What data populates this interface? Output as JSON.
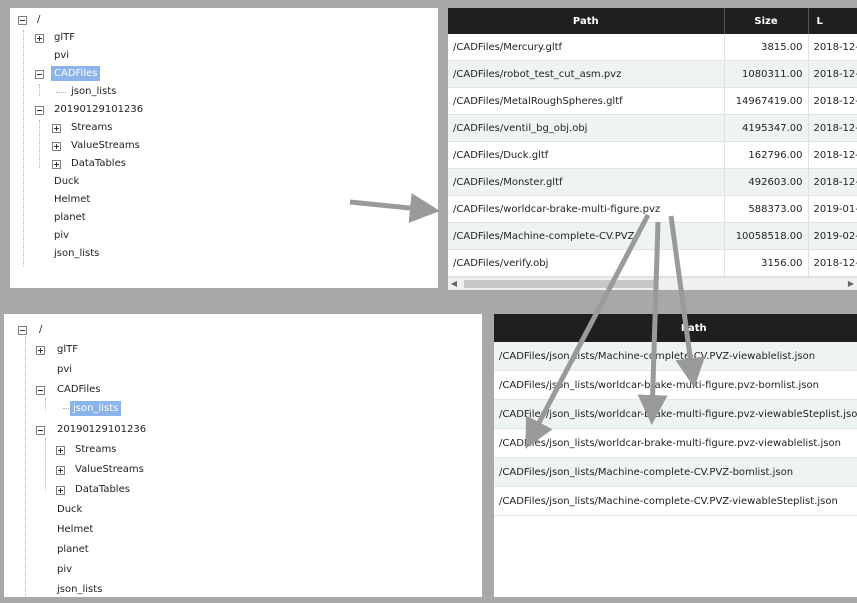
{
  "top_tree": {
    "nodes": [
      {
        "label": "/",
        "toggle": "minus"
      },
      {
        "label": "glTF",
        "toggle": "plus"
      },
      {
        "label": "pvi",
        "toggle": ""
      },
      {
        "label": "CADFiles",
        "toggle": "minus",
        "selected": true
      },
      {
        "label": "json_lists",
        "toggle": ""
      },
      {
        "label": "20190129101236",
        "toggle": "minus"
      },
      {
        "label": "Streams",
        "toggle": "plus"
      },
      {
        "label": "ValueStreams",
        "toggle": "plus"
      },
      {
        "label": "DataTables",
        "toggle": "plus"
      },
      {
        "label": "Duck",
        "toggle": ""
      },
      {
        "label": "Helmet",
        "toggle": ""
      },
      {
        "label": "planet",
        "toggle": ""
      },
      {
        "label": "piv",
        "toggle": ""
      },
      {
        "label": "json_lists",
        "toggle": ""
      }
    ]
  },
  "top_table": {
    "columns": [
      "Path",
      "Size",
      "L"
    ],
    "rows": [
      {
        "path": "/CADFiles/Mercury.gltf",
        "size": "3815.00",
        "date": "2018-12-"
      },
      {
        "path": "/CADFiles/robot_test_cut_asm.pvz",
        "size": "1080311.00",
        "date": "2018-12-"
      },
      {
        "path": "/CADFiles/MetalRoughSpheres.gltf",
        "size": "14967419.00",
        "date": "2018-12-"
      },
      {
        "path": "/CADFiles/ventil_bg_obj.obj",
        "size": "4195347.00",
        "date": "2018-12-"
      },
      {
        "path": "/CADFiles/Duck.gltf",
        "size": "162796.00",
        "date": "2018-12-"
      },
      {
        "path": "/CADFiles/Monster.gltf",
        "size": "492603.00",
        "date": "2018-12-"
      },
      {
        "path": "/CADFiles/worldcar-brake-multi-figure.pvz",
        "size": "588373.00",
        "date": "2019-01-"
      },
      {
        "path": "/CADFiles/Machine-complete-CV.PVZ",
        "size": "10058518.00",
        "date": "2019-02-"
      },
      {
        "path": "/CADFiles/verify.obj",
        "size": "3156.00",
        "date": "2018-12-"
      }
    ]
  },
  "bottom_tree": {
    "nodes": [
      {
        "label": "/",
        "toggle": "minus"
      },
      {
        "label": "glTF",
        "toggle": "plus"
      },
      {
        "label": "pvi",
        "toggle": ""
      },
      {
        "label": "CADFiles",
        "toggle": "minus"
      },
      {
        "label": "json_lists",
        "toggle": "",
        "selected": true
      },
      {
        "label": "20190129101236",
        "toggle": "minus"
      },
      {
        "label": "Streams",
        "toggle": "plus"
      },
      {
        "label": "ValueStreams",
        "toggle": "plus"
      },
      {
        "label": "DataTables",
        "toggle": "plus"
      },
      {
        "label": "Duck",
        "toggle": ""
      },
      {
        "label": "Helmet",
        "toggle": ""
      },
      {
        "label": "planet",
        "toggle": ""
      },
      {
        "label": "piv",
        "toggle": ""
      },
      {
        "label": "json_lists",
        "toggle": ""
      }
    ]
  },
  "bottom_table": {
    "columns": [
      "Path"
    ],
    "rows": [
      "/CADFiles/json_lists/Machine-complete-CV.PVZ-viewablelist.json",
      "/CADFiles/json_lists/worldcar-brake-multi-figure.pvz-bomlist.json",
      "/CADFiles/json_lists/worldcar-brake-multi-figure.pvz-viewableSteplist.json",
      "/CADFiles/json_lists/worldcar-brake-multi-figure.pvz-viewablelist.json",
      "/CADFiles/json_lists/Machine-complete-CV.PVZ-bomlist.json",
      "/CADFiles/json_lists/Machine-complete-CV.PVZ-viewableSteplist.json"
    ]
  },
  "annotation": {
    "arrow_color": "#9a9a9a"
  }
}
